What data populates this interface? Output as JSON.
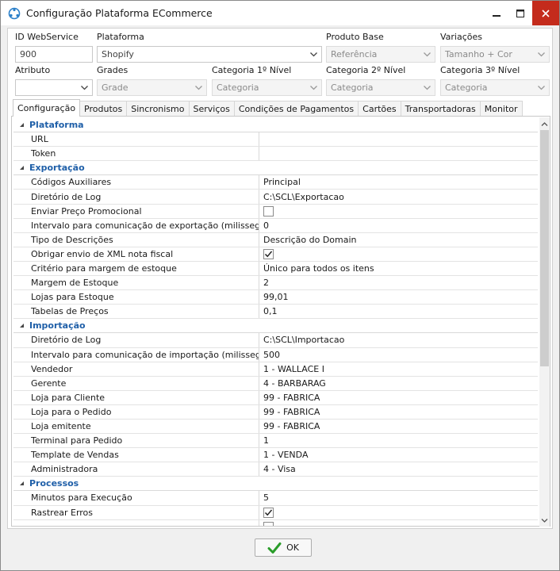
{
  "window": {
    "title": "Configuração Plataforma ECommerce"
  },
  "header": {
    "id_webservice": {
      "label": "ID WebService",
      "value": "900"
    },
    "plataforma": {
      "label": "Plataforma",
      "value": "Shopify"
    },
    "produto_base": {
      "label": "Produto Base",
      "value": "Referência"
    },
    "variacoes": {
      "label": "Variações",
      "value": "Tamanho + Cor"
    },
    "atributo": {
      "label": "Atributo",
      "value": ""
    },
    "grades": {
      "label": "Grades",
      "value": "Grade"
    },
    "categoria1": {
      "label": "Categoria 1º Nível",
      "value": "Categoria"
    },
    "categoria2": {
      "label": "Categoria 2º Nível",
      "value": "Categoria"
    },
    "categoria3": {
      "label": "Categoria 3º Nível",
      "value": "Categoria"
    }
  },
  "tabs": [
    {
      "label": "Configuração",
      "active": true
    },
    {
      "label": "Produtos"
    },
    {
      "label": "Sincronismo"
    },
    {
      "label": "Serviços"
    },
    {
      "label": "Condições de Pagamentos"
    },
    {
      "label": "Cartões"
    },
    {
      "label": "Transportadoras"
    },
    {
      "label": "Monitor"
    }
  ],
  "grid": {
    "categories": [
      {
        "name": "Plataforma",
        "rows": [
          {
            "name": "URL",
            "value": ""
          },
          {
            "name": "Token",
            "value": ""
          }
        ]
      },
      {
        "name": "Exportação",
        "rows": [
          {
            "name": "Códigos Auxiliares",
            "value": "Principal"
          },
          {
            "name": "Diretório de Log",
            "value": "C:\\SCL\\Exportacao"
          },
          {
            "name": "Enviar Preço Promocional",
            "checkbox": true,
            "checked": false
          },
          {
            "name": "Intervalo para comunicação de exportação (milissegundos)",
            "value": "0"
          },
          {
            "name": "Tipo de Descrições",
            "value": "Descrição do Domain"
          },
          {
            "name": "Obrigar envio de XML nota fiscal",
            "checkbox": true,
            "checked": true
          },
          {
            "name": "Critério para margem de estoque",
            "value": "Único para todos os itens"
          },
          {
            "name": "Margem de Estoque",
            "value": "2"
          },
          {
            "name": "Lojas para Estoque",
            "value": "99,01"
          },
          {
            "name": "Tabelas de Preços",
            "value": "0,1"
          }
        ]
      },
      {
        "name": "Importação",
        "rows": [
          {
            "name": "Diretório de Log",
            "value": "C:\\SCL\\Importacao"
          },
          {
            "name": "Intervalo para comunicação de importação (milissegundos)",
            "value": "500"
          },
          {
            "name": "Vendedor",
            "value": "1 - WALLACE I"
          },
          {
            "name": "Gerente",
            "value": "4 - BARBARAG"
          },
          {
            "name": "Loja para Cliente",
            "value": "99 - FABRICA"
          },
          {
            "name": "Loja para o Pedido",
            "value": "99 - FABRICA"
          },
          {
            "name": "Loja emitente",
            "value": "99 - FABRICA"
          },
          {
            "name": "Terminal para Pedido",
            "value": "1"
          },
          {
            "name": "Template de Vendas",
            "value": "1 - VENDA"
          },
          {
            "name": "Administradora",
            "value": "4 - Visa"
          }
        ]
      },
      {
        "name": "Processos",
        "rows": [
          {
            "name": "Minutos para Execução",
            "value": "5"
          },
          {
            "name": "Rastrear Erros",
            "checkbox": true,
            "checked": true
          },
          {
            "name": "",
            "checkbox": true,
            "checked": false
          }
        ]
      }
    ]
  },
  "footer": {
    "ok_label": "OK"
  },
  "colors": {
    "category_text": "#1f5fa8",
    "close_button": "#c42b1c",
    "ok_check": "#2a9d2a"
  }
}
